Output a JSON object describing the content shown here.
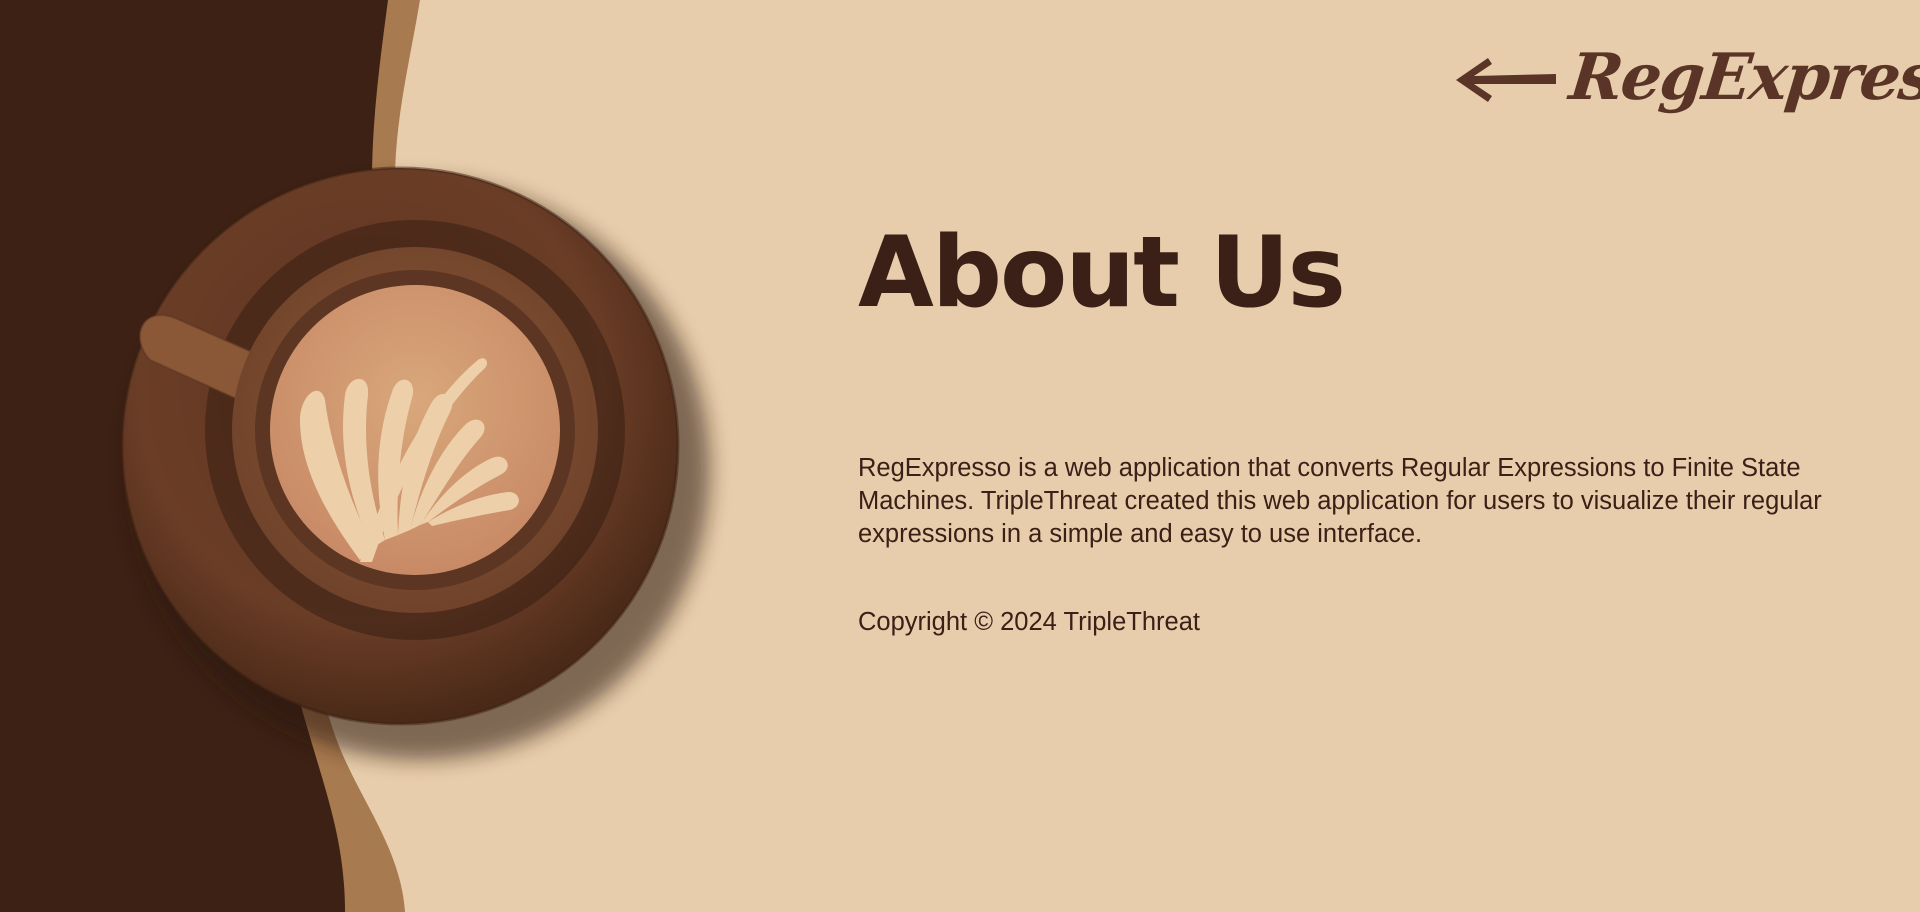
{
  "header": {
    "logo_text": "RegExpresso",
    "back_link_icon": "arrow-left-icon",
    "logo_cup_icon": "coffee-cup-icon"
  },
  "main": {
    "title": "About Us",
    "description": "RegExpresso is a web application that converts Regular Expressions to Finite State Machines. TripleThreat created this web application for users to visualize their regular expressions in a simple and easy to use interface.",
    "copyright": "Copyright © 2024 TripleThreat"
  },
  "illustration": {
    "icon": "latte-cup-illustration"
  },
  "colors": {
    "background": "#e7cdab",
    "dark_brown": "#3c2114",
    "caramel": "#a87a4f",
    "text": "#3a2017",
    "logo": "#5a3426"
  }
}
